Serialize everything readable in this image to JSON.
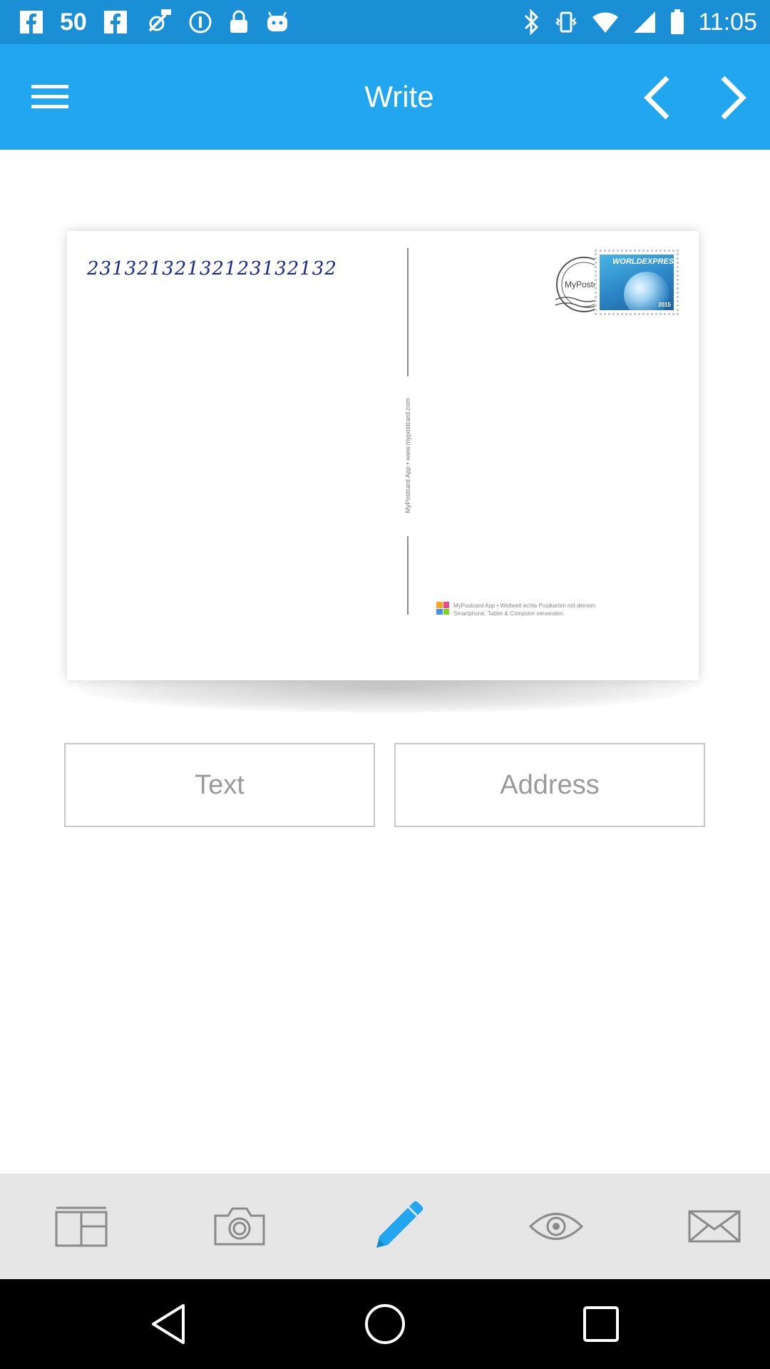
{
  "status_bar": {
    "signal_text": "50",
    "time": "11:05",
    "left_icons": [
      "fb-icon",
      "fb-icon",
      "fb-icon",
      "fake-gps-icon",
      "info-icon",
      "lock-icon",
      "android-icon"
    ],
    "right_icons": [
      "bluetooth-icon",
      "vibrate-icon",
      "wifi-icon",
      "signal-icon",
      "battery-icon"
    ]
  },
  "app_bar": {
    "title": "Write",
    "color": "#22a6ef",
    "menu_icon": "hamburger-menu-icon",
    "prev_icon": "chevron-left-icon",
    "next_icon": "chevron-right-icon"
  },
  "postcard": {
    "message": "23132132132123132132",
    "vertical_text": "MyPostcard App • www.mypostcard.com",
    "postmark_text": "MyPostcard",
    "stamp_label": "WORLDEXPRESS",
    "stamp_year": "2015",
    "footer_text": "MyPostcard App • Weltweit echte Postkarten mit deinem Smartphone, Tablet & Computer versenden."
  },
  "segments": {
    "text_label": "Text",
    "address_label": "Address"
  },
  "toolbar": {
    "items": [
      "layout-icon",
      "camera-icon",
      "pencil-icon",
      "eye-icon",
      "envelope-icon"
    ],
    "active": "pencil-icon",
    "active_color": "#22a6ef",
    "inactive_color": "#8a8a8a"
  },
  "system_nav": {
    "items": [
      "back-icon",
      "home-icon",
      "recents-icon"
    ]
  }
}
